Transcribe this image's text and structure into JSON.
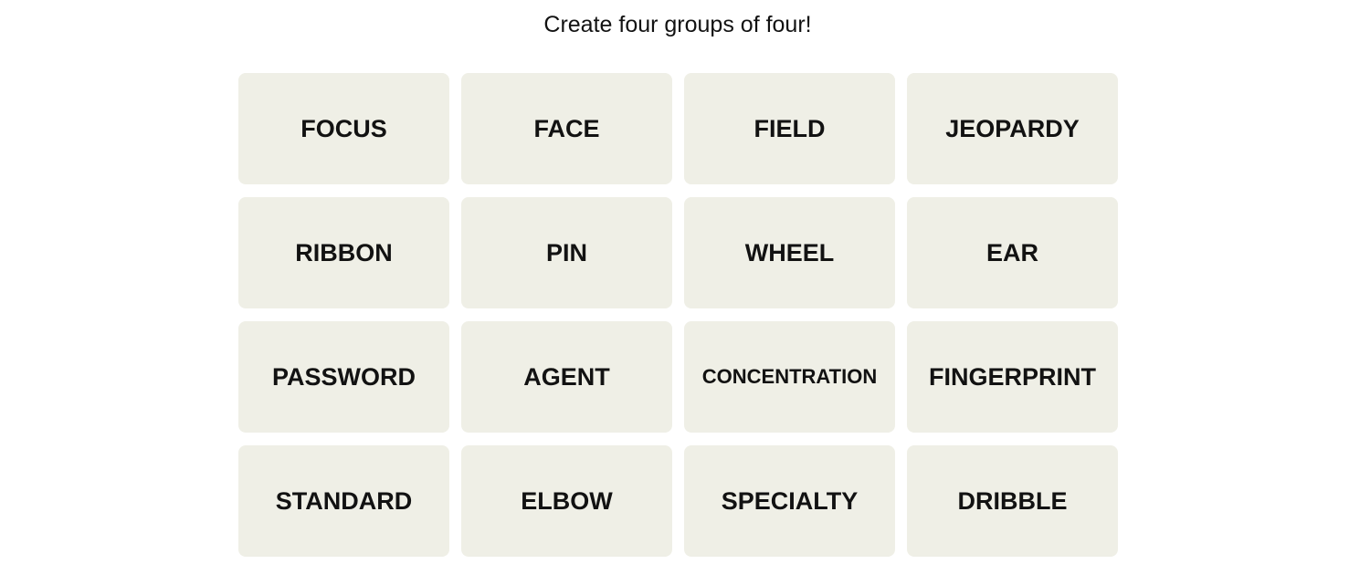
{
  "game": {
    "instructions": "Create four groups of four!",
    "tile_color": "#efefe6",
    "text_color": "#121212"
  },
  "tiles": [
    {
      "label": "FOCUS"
    },
    {
      "label": "FACE"
    },
    {
      "label": "FIELD"
    },
    {
      "label": "JEOPARDY"
    },
    {
      "label": "RIBBON"
    },
    {
      "label": "PIN"
    },
    {
      "label": "WHEEL"
    },
    {
      "label": "EAR"
    },
    {
      "label": "PASSWORD"
    },
    {
      "label": "AGENT"
    },
    {
      "label": "CONCENTRATION"
    },
    {
      "label": "FINGERPRINT"
    },
    {
      "label": "STANDARD"
    },
    {
      "label": "ELBOW"
    },
    {
      "label": "SPECIALTY"
    },
    {
      "label": "DRIBBLE"
    }
  ]
}
